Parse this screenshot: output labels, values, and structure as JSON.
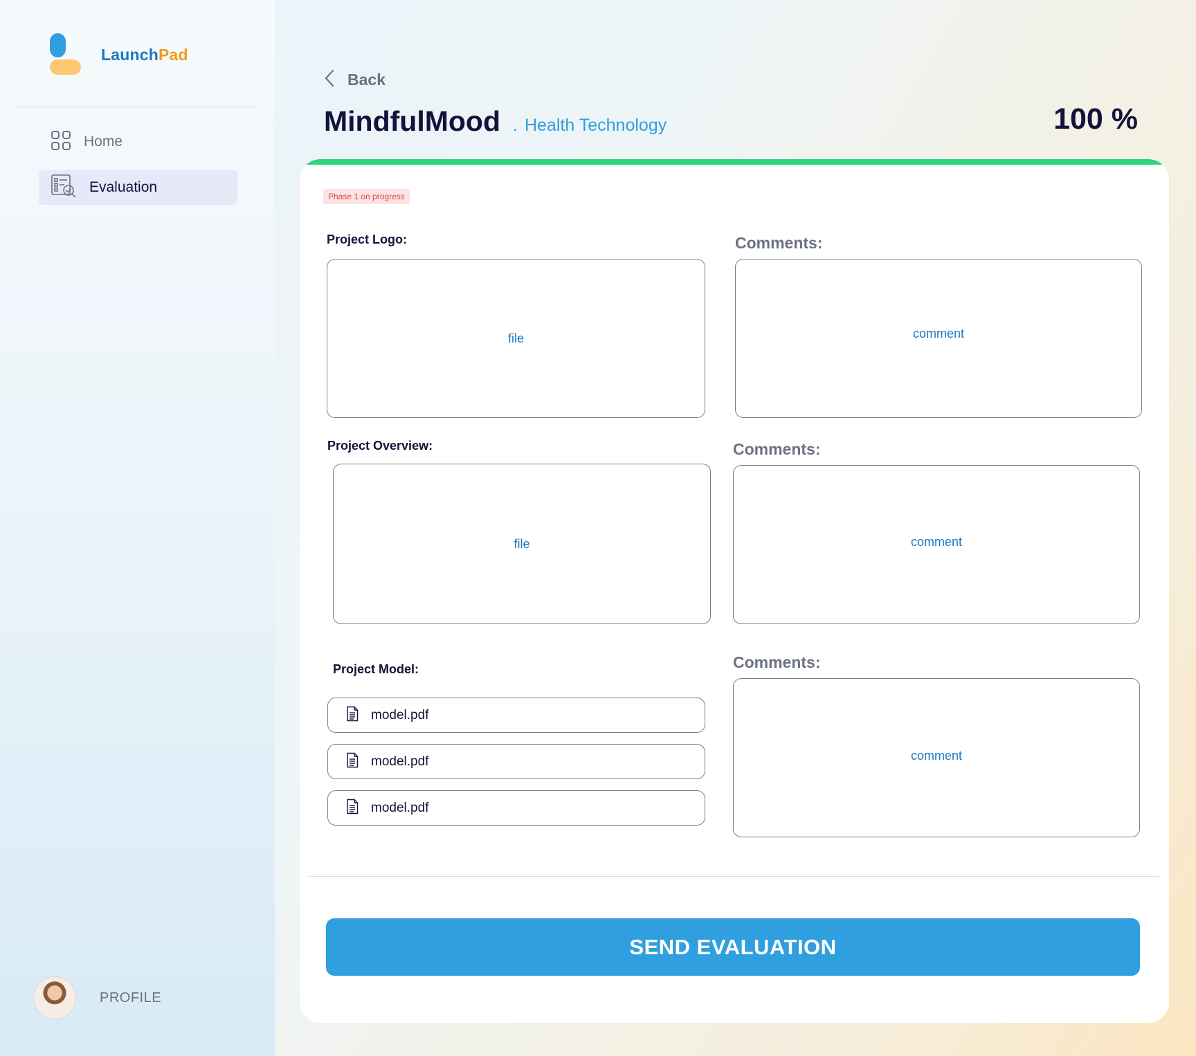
{
  "app": {
    "brand_part1": "Launch",
    "brand_part2": "Pad",
    "colors": {
      "brand_blue": "#2f9fe0",
      "brand_yellow": "#fcc771",
      "progress_green": "#2ed47a"
    }
  },
  "sidebar": {
    "items": [
      {
        "label": "Home",
        "icon": "grid-icon",
        "active": false
      },
      {
        "label": "Evaluation",
        "icon": "evaluation-icon",
        "active": true
      }
    ],
    "profile": {
      "label": "PROFILE"
    }
  },
  "header": {
    "back_label": "Back",
    "title": "MindfulMood",
    "category_dot": ".",
    "category": "Health Technology",
    "progress_label": "100 %",
    "progress_value": 1.0
  },
  "card": {
    "badge": "Phase 1 on progress",
    "sections": [
      {
        "label": "Project Logo:",
        "file_placeholder": "file",
        "comments_label": "Comments:",
        "comment_placeholder": "comment"
      },
      {
        "label": "Project Overview:",
        "file_placeholder": "file",
        "comments_label": "Comments:",
        "comment_placeholder": "comment"
      },
      {
        "label": "Project Model:",
        "files": [
          "model.pdf",
          "model.pdf",
          "model.pdf"
        ],
        "comments_label": "Comments:",
        "comment_placeholder": "comment"
      }
    ],
    "send_button": "SEND EVALUATION"
  }
}
